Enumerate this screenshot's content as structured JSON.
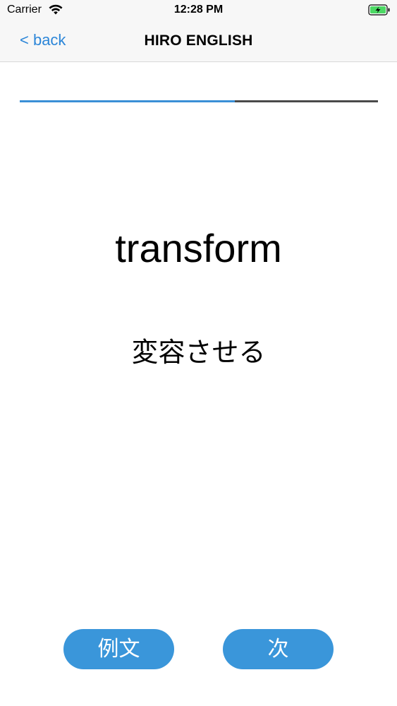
{
  "status_bar": {
    "carrier": "Carrier",
    "time": "12:28 PM",
    "wifi_icon": "wifi-icon",
    "battery_icon": "battery-charging-icon"
  },
  "nav": {
    "back_label": "< back",
    "title": "HIRO ENGLISH"
  },
  "progress": {
    "fraction": 0.6
  },
  "card": {
    "word": "transform",
    "meaning": "変容させる"
  },
  "actions": {
    "example_label": "例文",
    "next_label": "次"
  },
  "colors": {
    "accent": "#2c86d8",
    "button": "#3a96da",
    "progress_fill": "#3a8fd6",
    "progress_track": "#4a4a4a",
    "battery": "#4cd964"
  }
}
